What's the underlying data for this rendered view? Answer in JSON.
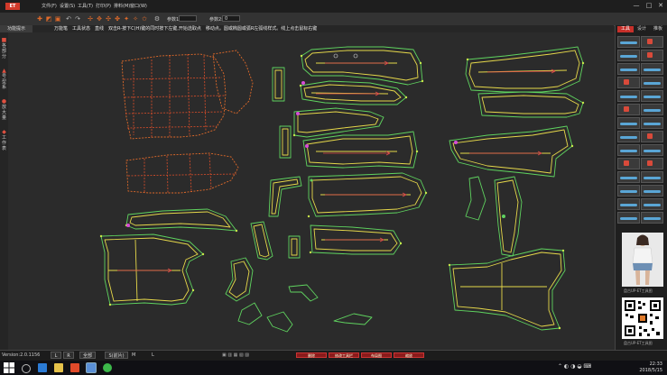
{
  "menubar": {
    "logo": "ET",
    "items": [
      "文件(F)",
      "设置(S)",
      "工具(T)",
      "打印(P)",
      "排料(M)",
      "窗口(W)"
    ],
    "window_controls": [
      "—",
      "□",
      "✕"
    ]
  },
  "toolbar": {
    "param1_label": "参数1:",
    "param1_value": "",
    "param2_label": "参数2:",
    "param2_value": "0"
  },
  "hint": {
    "tab": "功能提示",
    "text": "万能笔　工具状态　直线　双击R-按下C(H)键的同时按下左键,开始选取点　移动点。圆或椭圆或弧R左弧线样式。线上点击鼠标右键"
  },
  "left_tabs": [
    {
      "label": "各部分",
      "icon": "■"
    },
    {
      "label": "号型系",
      "icon": "▲"
    },
    {
      "label": "放大量",
      "icon": "●"
    },
    {
      "label": "工作表",
      "icon": "◆"
    }
  ],
  "right_panel": {
    "tabs": [
      "工具",
      "设计",
      "推板"
    ],
    "photo_caption": "盘古UP-ET工具图",
    "qr_caption": "盘古UP-ET工具图"
  },
  "statusbar": {
    "version": "Version:2.0.1156",
    "buttons": [
      "L",
      "R",
      "全部"
    ],
    "size_select": "S(前片)",
    "mode": "M",
    "size_l": "L",
    "action_buttons": [
      "删除",
      "修改工具栏",
      "布局图",
      "缩放"
    ]
  },
  "clock": {
    "time": "22:33",
    "date": "2018/5/15"
  },
  "colors": {
    "accent": "#c7302a",
    "piece_outline_green": "#5fd35f",
    "piece_inner_yellow": "#e6d84a",
    "piece_dashed_orange": "#e06a2a",
    "point_magenta": "#d84cd8",
    "grainline_red": "#e04a4a"
  }
}
